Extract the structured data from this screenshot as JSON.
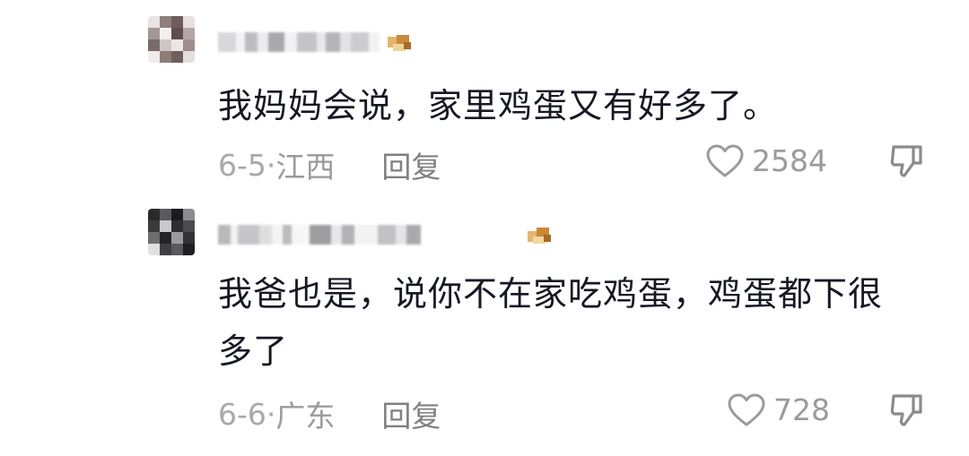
{
  "comments": [
    {
      "text": "我妈妈会说，家里鸡蛋又有好多了。",
      "date": "6-5·",
      "location": "江西",
      "reply_label": "回复",
      "likes": "2584"
    },
    {
      "text_line1": "我爸也是，说你不在家吃鸡蛋，鸡蛋都下很",
      "text_line2": "多了",
      "date": "6-6·",
      "location": "广东",
      "reply_label": "回复",
      "likes": "728"
    }
  ],
  "icons": {
    "like": "heart-outline-icon",
    "dislike": "thumbs-down-icon"
  },
  "colors": {
    "text": "#161823",
    "meta": "#9a9a9f",
    "background": "#ffffff"
  }
}
